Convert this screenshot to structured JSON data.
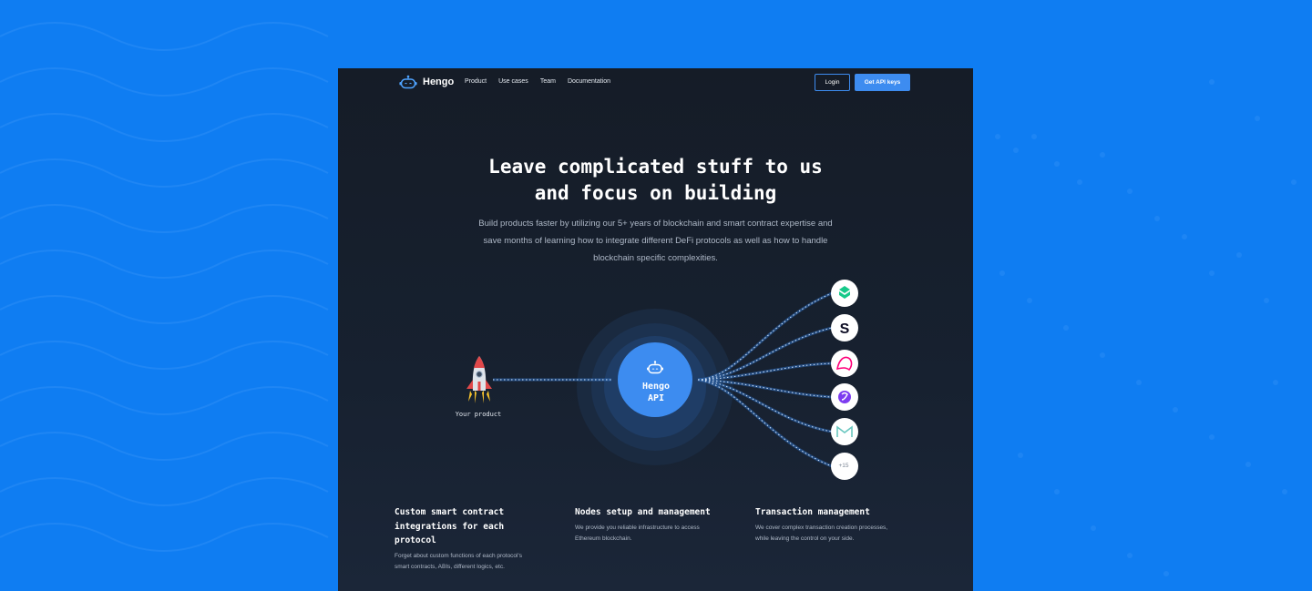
{
  "brand": {
    "name": "Hengo"
  },
  "nav": {
    "links": [
      "Product",
      "Use cases",
      "Team",
      "Documentation"
    ],
    "login_label": "Login",
    "api_label": "Get API keys"
  },
  "hero": {
    "title_line1": "Leave complicated stuff to us",
    "title_line2": "and focus on building",
    "subtitle_line1": "Build products faster by utilizing our 5+ years of blockchain and smart contract expertise and",
    "subtitle_line2": "save months of learning how to integrate different DeFi protocols as well as how to handle",
    "subtitle_line3": "blockchain specific complexities."
  },
  "diagram": {
    "product_label": "Your product",
    "api_line1": "Hengo",
    "api_line2": "API",
    "protocols": [
      "compound-icon",
      "synthetix-icon",
      "uniswap-icon",
      "polygon-icon",
      "maker-icon"
    ],
    "more_label": "+15"
  },
  "features": [
    {
      "title_lines": [
        "Custom smart contract",
        "integrations for each",
        "protocol"
      ],
      "desc_lines": [
        "Forget about custom functions of each protocol's",
        "smart contracts, ABIs, different logics, etc."
      ]
    },
    {
      "title_lines": [
        "Nodes setup and management"
      ],
      "desc_lines": [
        "We provide you reliable infrastructure to access",
        "Ethereum blockchain."
      ]
    },
    {
      "title_lines": [
        "Transaction management"
      ],
      "desc_lines": [
        "We cover complex transaction creation processes,",
        "while leaving the control on your side."
      ]
    }
  ],
  "colors": {
    "page_bg": "#0f7df2",
    "frame_bg": "#151c27",
    "accent": "#3d8cf0"
  }
}
